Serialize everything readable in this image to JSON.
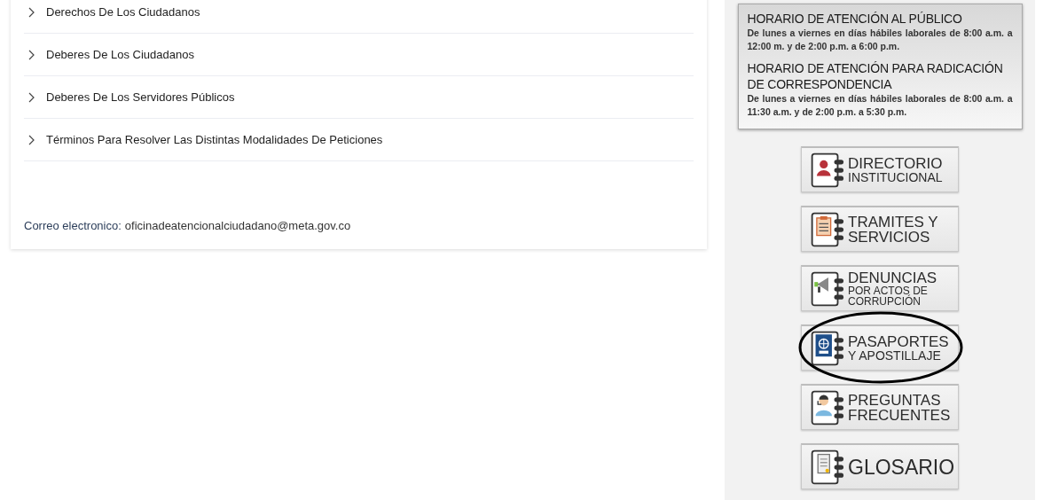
{
  "accordion": [
    {
      "label": "Derechos De Los Ciudadanos",
      "expanded": false
    },
    {
      "label": "Deberes De Los Ciudadanos",
      "expanded": false
    },
    {
      "label": "Deberes De Los Servidores Públicos",
      "expanded": false
    },
    {
      "label": "Términos Para Resolver Las Distintas Modalidades De Peticiones",
      "expanded": false
    }
  ],
  "contact": {
    "label": "Correo electronico:",
    "email": "oficinadeatencionalciudadano@meta.gov.co"
  },
  "schedule": [
    {
      "heading": "HORARIO DE ATENCIÓN AL PÚBLICO",
      "body": "De lunes a viernes en días hábiles laborales de 8:00 a.m. a 12:00 m. y de 2:00 p.m. a 6:00 p.m."
    },
    {
      "heading": "HORARIO DE ATENCIÓN PARA RADICACIÓN DE CORRESPONDENCIA",
      "body": "De lunes a viernes en días hábiles laborales de 8:00 a.m. a 11:30 a.m. y de 2:00 p.m. a 5:30 p.m."
    }
  ],
  "links": [
    {
      "kind": "person",
      "lines": [
        {
          "text": "DIRECTORIO",
          "kind": "main"
        },
        {
          "text": "INSTITUCIONAL",
          "kind": "sub"
        }
      ],
      "highlighted": false
    },
    {
      "kind": "clipboard",
      "lines": [
        {
          "text": "TRAMITES Y",
          "kind": "main"
        },
        {
          "text": "SERVICIOS",
          "kind": "main"
        }
      ],
      "highlighted": false
    },
    {
      "kind": "megaphone",
      "lines": [
        {
          "text": "DENUNCIAS",
          "kind": "main"
        },
        {
          "text": "POR ACTOS DE",
          "kind": "small"
        },
        {
          "text": "CORRUPCIÓN",
          "kind": "small"
        }
      ],
      "highlighted": false
    },
    {
      "kind": "passport",
      "lines": [
        {
          "text": "PASAPORTES",
          "kind": "main"
        },
        {
          "text": "Y APOSTILLAJE",
          "kind": "sub"
        }
      ],
      "highlighted": true
    },
    {
      "kind": "agent",
      "lines": [
        {
          "text": "PREGUNTAS",
          "kind": "main"
        },
        {
          "text": "FRECUENTES",
          "kind": "main"
        }
      ],
      "highlighted": false
    },
    {
      "kind": "scroll",
      "lines": [
        {
          "text": "GLOSARIO",
          "kind": "big"
        }
      ],
      "highlighted": false
    }
  ]
}
